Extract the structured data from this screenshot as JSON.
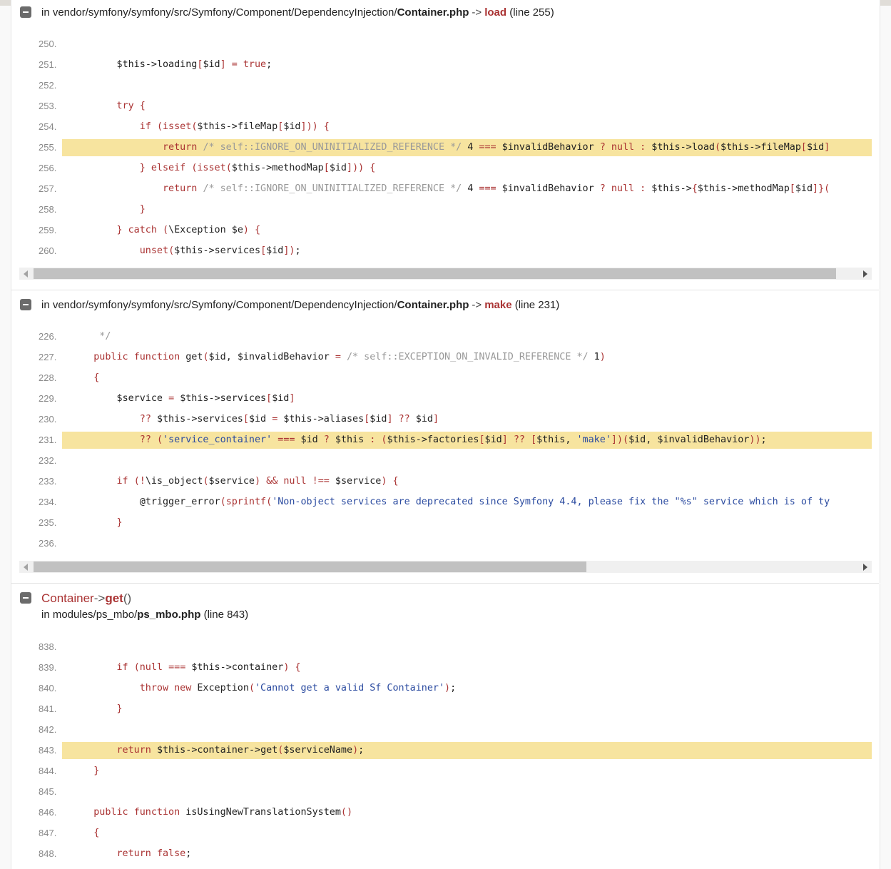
{
  "frames": [
    {
      "prefix": "in vendor/symfony/symfony/src/Symfony/Component/DependencyInjection/",
      "file": "Container.php",
      "arrow": "->",
      "function": "load",
      "line_info": "(line 255)",
      "lines": [
        {
          "n": "250.",
          "code": ""
        },
        {
          "n": "251.",
          "code": "        $this->loading[$id] = true;"
        },
        {
          "n": "252.",
          "code": ""
        },
        {
          "n": "253.",
          "code": "        try {"
        },
        {
          "n": "254.",
          "code": "            if (isset($this->fileMap[$id])) {"
        },
        {
          "n": "255.",
          "code": "                return /* self::IGNORE_ON_UNINITIALIZED_REFERENCE */ 4 === $invalidBehavior ? null : $this->load($this->fileMap[$id]"
        },
        {
          "n": "256.",
          "code": "            } elseif (isset($this->methodMap[$id])) {"
        },
        {
          "n": "257.",
          "code": "                return /* self::IGNORE_ON_UNINITIALIZED_REFERENCE */ 4 === $invalidBehavior ? null : $this->{$this->methodMap[$id]}("
        },
        {
          "n": "258.",
          "code": "            }"
        },
        {
          "n": "259.",
          "code": "        } catch (\\Exception $e) {"
        },
        {
          "n": "260.",
          "code": "            unset($this->services[$id]);"
        }
      ]
    },
    {
      "prefix": "in vendor/symfony/symfony/src/Symfony/Component/DependencyInjection/",
      "file": "Container.php",
      "arrow": "->",
      "function": "make",
      "line_info": "(line 231)",
      "lines": [
        {
          "n": "226.",
          "code": "     */"
        },
        {
          "n": "227.",
          "code": "    public function get($id, $invalidBehavior = /* self::EXCEPTION_ON_INVALID_REFERENCE */ 1)"
        },
        {
          "n": "228.",
          "code": "    {"
        },
        {
          "n": "229.",
          "code": "        $service = $this->services[$id]"
        },
        {
          "n": "230.",
          "code": "            ?? $this->services[$id = $this->aliases[$id] ?? $id]"
        },
        {
          "n": "231.",
          "code": "            ?? ('service_container' === $id ? $this : ($this->factories[$id] ?? [$this, 'make'])($id, $invalidBehavior));"
        },
        {
          "n": "232.",
          "code": ""
        },
        {
          "n": "233.",
          "code": "        if (!\\is_object($service) && null !== $service) {"
        },
        {
          "n": "234.",
          "code": "            @trigger_error(sprintf('Non-object services are deprecated since Symfony 4.4, please fix the \"%s\" service which is of ty"
        },
        {
          "n": "235.",
          "code": "        }"
        },
        {
          "n": "236.",
          "code": ""
        }
      ]
    },
    {
      "class": "Container",
      "arrow": "->",
      "method": "get",
      "parens": "()",
      "prefix": "in modules/ps_mbo/",
      "file": "ps_mbo.php",
      "line_info": "(line 843)",
      "lines": [
        {
          "n": "838.",
          "code": ""
        },
        {
          "n": "839.",
          "code": "        if (null === $this->container) {"
        },
        {
          "n": "840.",
          "code": "            throw new Exception('Cannot get a valid Sf Container');"
        },
        {
          "n": "841.",
          "code": "        }"
        },
        {
          "n": "842.",
          "code": ""
        },
        {
          "n": "843.",
          "code": "        return $this->container->get($serviceName);"
        },
        {
          "n": "844.",
          "code": "    }"
        },
        {
          "n": "845.",
          "code": ""
        },
        {
          "n": "846.",
          "code": "    public function isUsingNewTranslationSystem()"
        },
        {
          "n": "847.",
          "code": "    {"
        },
        {
          "n": "848.",
          "code": "        return false;"
        }
      ]
    }
  ],
  "colors": {
    "highlight": "#f7e49f",
    "keyword": "#aa3333",
    "comment": "#999999",
    "string": "#2b4ba0",
    "toggle": "#6b6b6b"
  },
  "icons": [
    "collapse-icon",
    "scroll-left-icon",
    "scroll-right-icon"
  ]
}
